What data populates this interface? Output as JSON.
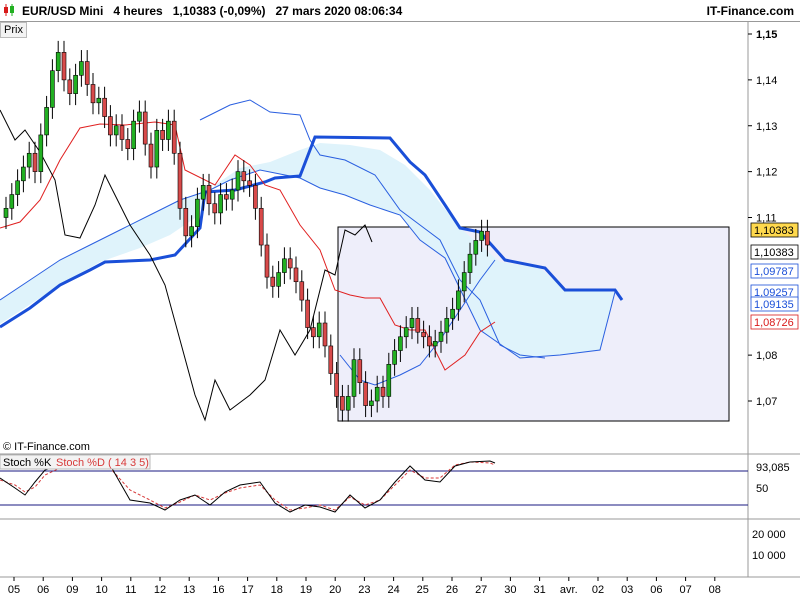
{
  "header": {
    "instrument": "EUR/USD Mini",
    "timeframe": "4 heures",
    "last": "1,10383",
    "change": "(-0,09%)",
    "datetime": "27 mars 2020 08:06:34",
    "brand": "IT-Finance.com"
  },
  "price_pane": {
    "label": "Prix",
    "watermark": "© IT-Finance.com",
    "y_ticks": [
      "1,15",
      "1,14",
      "1,13",
      "1,12",
      "1,11",
      "1,08",
      "1,07"
    ],
    "price_labels": [
      {
        "text": "1,10383",
        "color": "#000000",
        "bg": "#ffd94d"
      },
      {
        "text": "1,10383",
        "color": "#000000",
        "bg": "#ffffff"
      },
      {
        "text": "1,09787",
        "color": "#1a4fd8",
        "bg": "#ffffff"
      },
      {
        "text": "1,09257",
        "color": "#1a4fd8",
        "bg": "#ffffff"
      },
      {
        "text": "1,09135",
        "color": "#1a4fd8",
        "bg": "#ffffff"
      },
      {
        "text": "1,08726",
        "color": "#d81a1a",
        "bg": "#ffffff"
      }
    ]
  },
  "stoch_pane": {
    "label_k": "Stoch %K",
    "label_d": "Stoch %D ( 14 3 5)",
    "value_label": "93,085",
    "y_ticks": [
      "50"
    ]
  },
  "volume_pane": {
    "y_ticks": [
      "20 000",
      "10 000"
    ]
  },
  "x_axis": [
    "05",
    "06",
    "09",
    "10",
    "11",
    "12",
    "13",
    "16",
    "17",
    "18",
    "19",
    "20",
    "23",
    "24",
    "25",
    "26",
    "27",
    "30",
    "31",
    "avr.",
    "02",
    "03",
    "06",
    "07",
    "08"
  ],
  "colors": {
    "up_candle": "#22b022",
    "down_candle": "#d84a4a",
    "kumo_fill": "#dff3fb",
    "kijun": "#1a4fd8",
    "tenkan": "#e02020",
    "chikou": "#000000",
    "span_line": "#2a5fe0",
    "highlight_box": "#eeeefa",
    "stoch_k": "#7a6ccf",
    "stoch_d": "#d83a3a"
  },
  "chart_data": {
    "type": "candlestick",
    "title": "EUR/USD Mini 4 heures",
    "ylim": [
      1.064,
      1.154
    ],
    "y_ticks": [
      1.07,
      1.08,
      1.11,
      1.12,
      1.13,
      1.14,
      1.15
    ],
    "close_series": [
      1.112,
      1.115,
      1.118,
      1.121,
      1.124,
      1.12,
      1.128,
      1.134,
      1.142,
      1.146,
      1.14,
      1.137,
      1.141,
      1.144,
      1.139,
      1.135,
      1.136,
      1.132,
      1.128,
      1.13,
      1.127,
      1.125,
      1.131,
      1.133,
      1.126,
      1.121,
      1.129,
      1.127,
      1.131,
      1.124,
      1.112,
      1.106,
      1.108,
      1.114,
      1.117,
      1.113,
      1.111,
      1.115,
      1.114,
      1.116,
      1.12,
      1.118,
      1.117,
      1.112,
      1.104,
      1.097,
      1.095,
      1.098,
      1.101,
      1.099,
      1.096,
      1.092,
      1.086,
      1.084,
      1.087,
      1.082,
      1.076,
      1.071,
      1.068,
      1.071,
      1.079,
      1.074,
      1.069,
      1.07,
      1.073,
      1.071,
      1.078,
      1.081,
      1.084,
      1.086,
      1.088,
      1.085,
      1.084,
      1.082,
      1.083,
      1.085,
      1.088,
      1.09,
      1.094,
      1.098,
      1.102,
      1.105,
      1.107,
      1.104
    ],
    "indicators": {
      "stochastic": {
        "k_period": 14,
        "d_period": 3,
        "slowing": 5,
        "last": 93.085
      }
    }
  }
}
